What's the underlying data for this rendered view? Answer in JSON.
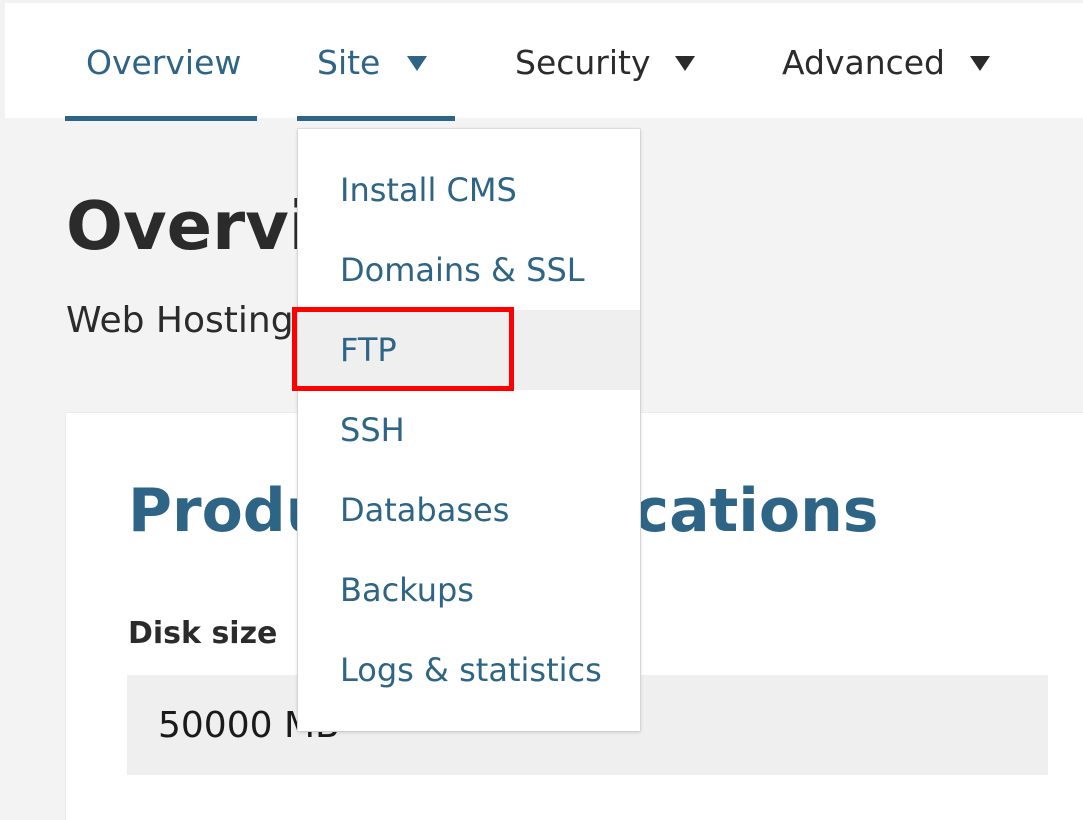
{
  "nav": {
    "overview": "Overview",
    "site": "Site",
    "security": "Security",
    "advanced": "Advanced"
  },
  "page": {
    "title": "Overview",
    "subtitle": "Web Hosting"
  },
  "card": {
    "title": "Product specifications",
    "disk_size_label": "Disk size",
    "disk_size_value": "50000 MB"
  },
  "site_menu": {
    "items": [
      "Install CMS",
      "Domains & SSL",
      "FTP",
      "SSH",
      "Databases",
      "Backups",
      "Logs & statistics"
    ],
    "highlighted": "FTP"
  },
  "icons": {
    "dropdown_caret": "caret-down-icon"
  },
  "colors": {
    "accent": "#2e6486",
    "text": "#2b2b2b",
    "highlight_border": "#ff0000",
    "hover_bg": "#efefef"
  }
}
